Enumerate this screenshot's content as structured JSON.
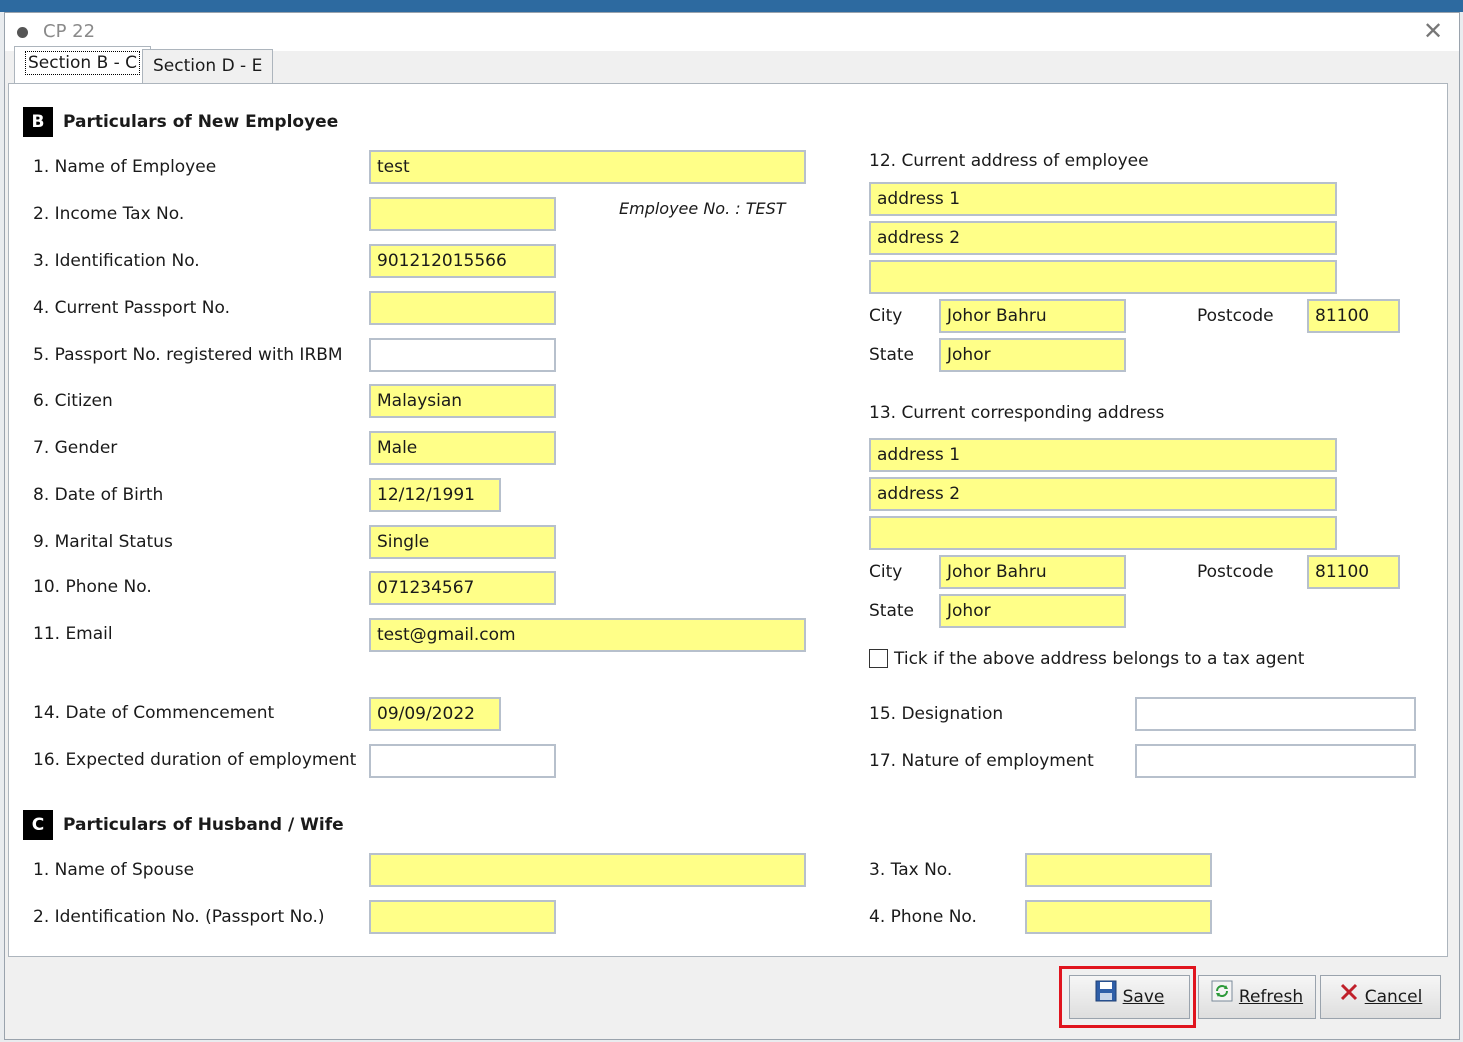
{
  "window": {
    "title": "CP 22"
  },
  "tabs": [
    {
      "label": "Section B - C",
      "active": true
    },
    {
      "label": "Section D - E",
      "active": false
    }
  ],
  "section_b": {
    "badge": "B",
    "title": "Particulars of New Employee",
    "employee_no_text": "Employee No. : TEST",
    "fields": {
      "name": {
        "label": "1. Name of Employee",
        "value": "test"
      },
      "income_tax": {
        "label": "2. Income Tax No.",
        "value": ""
      },
      "ident": {
        "label": "3. Identification No.",
        "value": "901212015566"
      },
      "passport": {
        "label": "4. Current Passport No.",
        "value": ""
      },
      "passport_irbm": {
        "label": "5. Passport No. registered with IRBM",
        "value": ""
      },
      "citizen": {
        "label": "6. Citizen",
        "value": "Malaysian"
      },
      "gender": {
        "label": "7. Gender",
        "value": "Male"
      },
      "dob": {
        "label": "8. Date of Birth",
        "value": "12/12/1991"
      },
      "marital": {
        "label": "9. Marital Status",
        "value": "Single"
      },
      "phone": {
        "label": "10. Phone No.",
        "value": "071234567"
      },
      "email": {
        "label": "11. Email",
        "value": "test@gmail.com"
      },
      "commencement": {
        "label": "14. Date of Commencement",
        "value": "09/09/2022"
      },
      "duration": {
        "label": "16. Expected duration of employment",
        "value": ""
      },
      "designation": {
        "label": "15. Designation",
        "value": ""
      },
      "nature": {
        "label": "17. Nature of employment",
        "value": ""
      }
    },
    "current_address": {
      "label": "12. Current address of employee",
      "line1": "address 1",
      "line2": "address 2",
      "line3": "",
      "city_label": "City",
      "city": "Johor Bahru",
      "postcode_label": "Postcode",
      "postcode": "81100",
      "state_label": "State",
      "state": "Johor"
    },
    "corr_address": {
      "label": "13. Current corresponding address",
      "line1": "address 1",
      "line2": "address 2",
      "line3": "",
      "city_label": "City",
      "city": "Johor Bahru",
      "postcode_label": "Postcode",
      "postcode": "81100",
      "state_label": "State",
      "state": "Johor"
    },
    "tax_agent_label": "Tick if the above address belongs to a tax agent",
    "tax_agent_checked": false
  },
  "section_c": {
    "badge": "C",
    "title": "Particulars of Husband / Wife",
    "spouse_name": {
      "label": "1. Name of Spouse",
      "value": ""
    },
    "spouse_ident": {
      "label": "2. Identification No. (Passport No.)",
      "value": ""
    },
    "tax_no": {
      "label": "3. Tax No.",
      "value": ""
    },
    "phone_no": {
      "label": "4. Phone No.",
      "value": ""
    }
  },
  "buttons": {
    "save": "Save",
    "refresh": "Refresh",
    "cancel": "Cancel"
  },
  "colors": {
    "required_field": "#ffff88",
    "highlight": "#e0141e"
  },
  "icons": {
    "save": "floppy-disk-icon",
    "refresh": "refresh-icon",
    "cancel": "x-icon"
  }
}
